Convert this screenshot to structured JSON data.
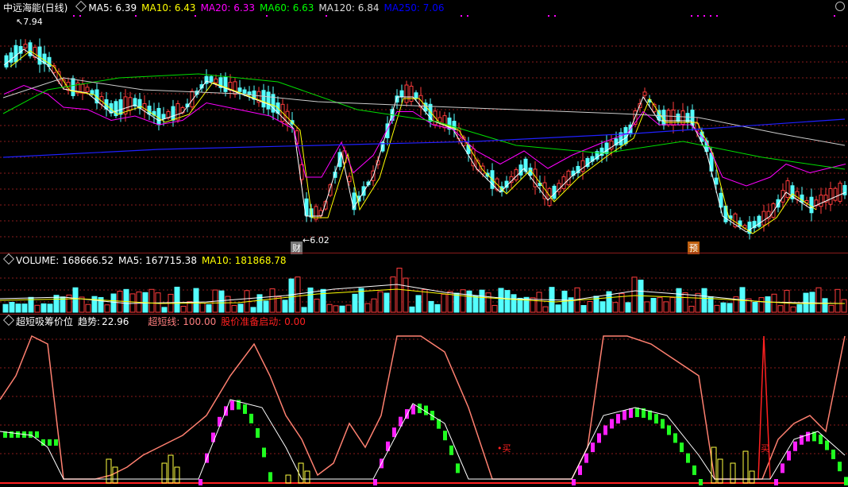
{
  "main": {
    "title": "中远海能(日线)",
    "ma": [
      {
        "label": "MA5: 6.39",
        "color": "#ffffff"
      },
      {
        "label": "MA10: 6.43",
        "color": "#ffff00"
      },
      {
        "label": "MA20: 6.33",
        "color": "#ff00ff"
      },
      {
        "label": "MA60: 6.63",
        "color": "#00ff00"
      },
      {
        "label": "MA120: 6.84",
        "color": "#dddddd"
      },
      {
        "label": "MA250: 7.06",
        "color": "#0000ff"
      }
    ],
    "high_label": "7.94",
    "low_label": "6.02",
    "marker_cai": "财",
    "marker_yu": "预"
  },
  "volume": {
    "label": "VOLUME: 168666.52",
    "ma5": "MA5: 167715.38",
    "ma10": "MA10: 181868.78"
  },
  "indicator": {
    "name": "超短吸筹价位",
    "trend_label": "趋势:",
    "trend_value": "22.96",
    "short_line": "超短线: 100.00",
    "start": "股价准备启动: 0.00",
    "buy1": "•买",
    "buy2": "买"
  },
  "colors": {
    "up": "#ff3c3c",
    "down": "#54ffff",
    "bg": "#000000",
    "grid": "#8a1c1c"
  }
}
